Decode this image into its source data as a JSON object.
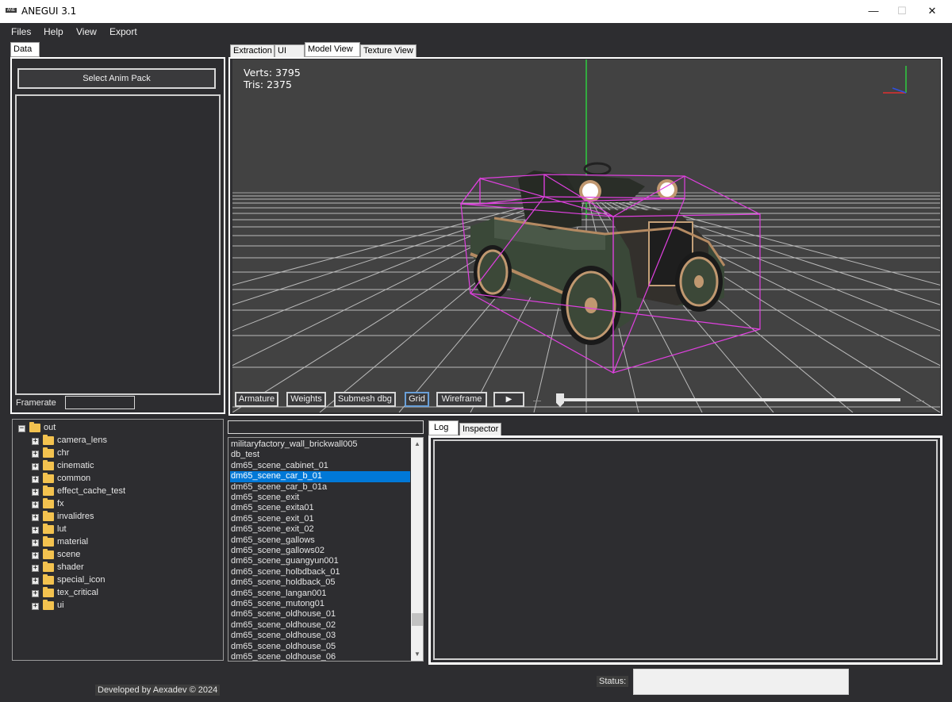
{
  "window": {
    "icon_text": "ANE",
    "title": "ANEGUI 3.1",
    "minimize_glyph": "—",
    "maximize_glyph": "☐",
    "close_glyph": "✕"
  },
  "menu": [
    "Files",
    "Help",
    "View",
    "Export"
  ],
  "left_panel": {
    "tab": "Data",
    "select_button": "Select Anim Pack",
    "framerate_label": "Framerate",
    "framerate_value": ""
  },
  "view_tabs": [
    "Extraction",
    "UI",
    "Model View",
    "Texture View"
  ],
  "active_view_tab": "Model View",
  "viewport": {
    "verts_text": "Verts: 3795",
    "tris_text": "Tris: 2375",
    "buttons": [
      "Armature",
      "Weights",
      "Submesh dbg",
      "Grid",
      "Wireframe"
    ],
    "active_button": "Grid",
    "play_glyph": "▶",
    "timeline_position": 0.0,
    "colors": {
      "background": "#424242",
      "grid": "#d0d0d0",
      "bounding_box": "#e040e0",
      "axis_y": "#2ecc40",
      "axis_x": "#e03030",
      "axis_z": "#3050e0"
    }
  },
  "tree": {
    "root": "out",
    "children": [
      "camera_lens",
      "chr",
      "cinematic",
      "common",
      "effect_cache_test",
      "fx",
      "invalidres",
      "lut",
      "material",
      "scene",
      "shader",
      "special_icon",
      "tex_critical",
      "ui"
    ]
  },
  "list": {
    "search_value": "",
    "items": [
      "militaryfactory_wall_brickwall005",
      "db_test",
      "dm65_scene_cabinet_01",
      "dm65_scene_car_b_01",
      "dm65_scene_car_b_01a",
      "dm65_scene_exit",
      "dm65_scene_exita01",
      "dm65_scene_exit_01",
      "dm65_scene_exit_02",
      "dm65_scene_gallows",
      "dm65_scene_gallows02",
      "dm65_scene_guangyun001",
      "dm65_scene_holbdback_01",
      "dm65_scene_holdback_05",
      "dm65_scene_langan001",
      "dm65_scene_mutong01",
      "dm65_scene_oldhouse_01",
      "dm65_scene_oldhouse_02",
      "dm65_scene_oldhouse_03",
      "dm65_scene_oldhouse_05",
      "dm65_scene_oldhouse_06"
    ],
    "selected": "dm65_scene_car_b_01",
    "scroll_up_glyph": "▲",
    "scroll_down_glyph": "▼"
  },
  "log_tabs": [
    "Log",
    "Inspector"
  ],
  "active_log_tab": "Log",
  "footer": {
    "credit": "Developed by Aexadev © 2024",
    "status_label": "Status:",
    "status_value": ""
  }
}
